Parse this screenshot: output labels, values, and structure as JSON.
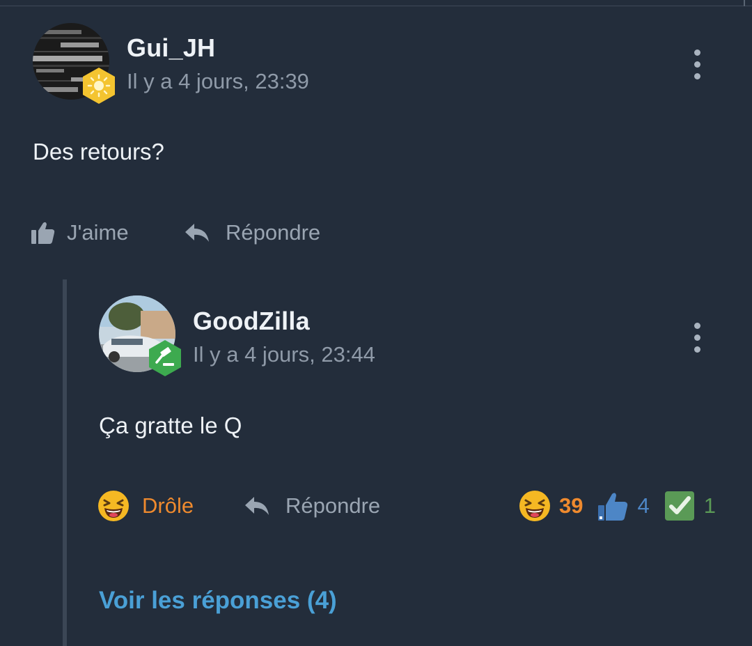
{
  "post": {
    "username": "Gui_JH",
    "timestamp": "Il y a 4 jours, 23:39",
    "body": "Des retours?",
    "like_label": "J'aime",
    "reply_label": "Répondre",
    "avatar_icon": "avatar-text-image",
    "badge_icon": "sun-icon",
    "badge_color": "#f4c430"
  },
  "reply": {
    "username": "GoodZilla",
    "timestamp": "Il y a 4 jours, 23:44",
    "body": "Ça gratte le Q",
    "reaction_label": "Drôle",
    "reply_label": "Répondre",
    "avatar_icon": "avatar-car-photo",
    "badge_icon": "gavel-icon",
    "badge_color": "#3daa4f",
    "reactions": [
      {
        "icon": "laughing-emoji-icon",
        "count": "39",
        "color": "#ef8a2e"
      },
      {
        "icon": "thumbs-up-icon",
        "count": "4",
        "color": "#4d86c6"
      },
      {
        "icon": "checkmark-icon",
        "count": "1",
        "color": "#5a9a56"
      }
    ],
    "see_replies": "Voir les réponses (4)"
  }
}
